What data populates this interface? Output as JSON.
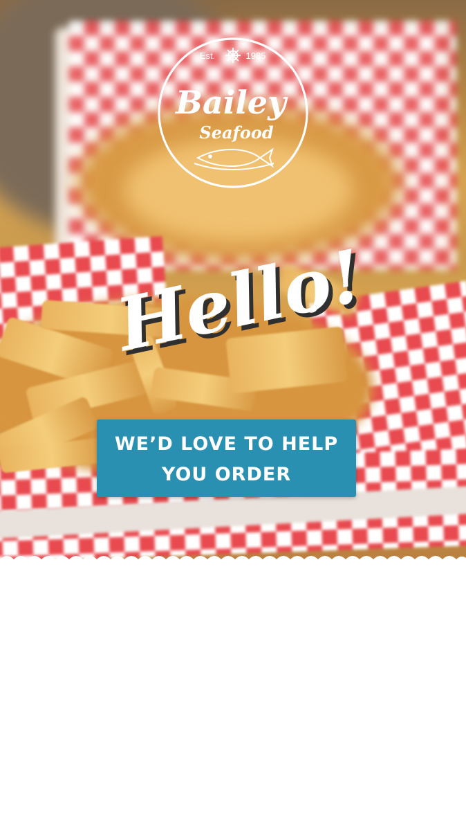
{
  "brand": {
    "name_line1": "Bailey",
    "name_line2": "Seafood",
    "est_left": "Est.",
    "est_right": "1985"
  },
  "hero": {
    "greeting": "Hello!"
  },
  "cta": {
    "label": "WE’D LOVE TO HELP YOU ORDER"
  },
  "colors": {
    "cta_background": "#2a90b2",
    "checker_red": "#e84a4f",
    "page_background": "#ffffff"
  },
  "icons": [
    "ship-wheel-icon",
    "fish-icon"
  ]
}
